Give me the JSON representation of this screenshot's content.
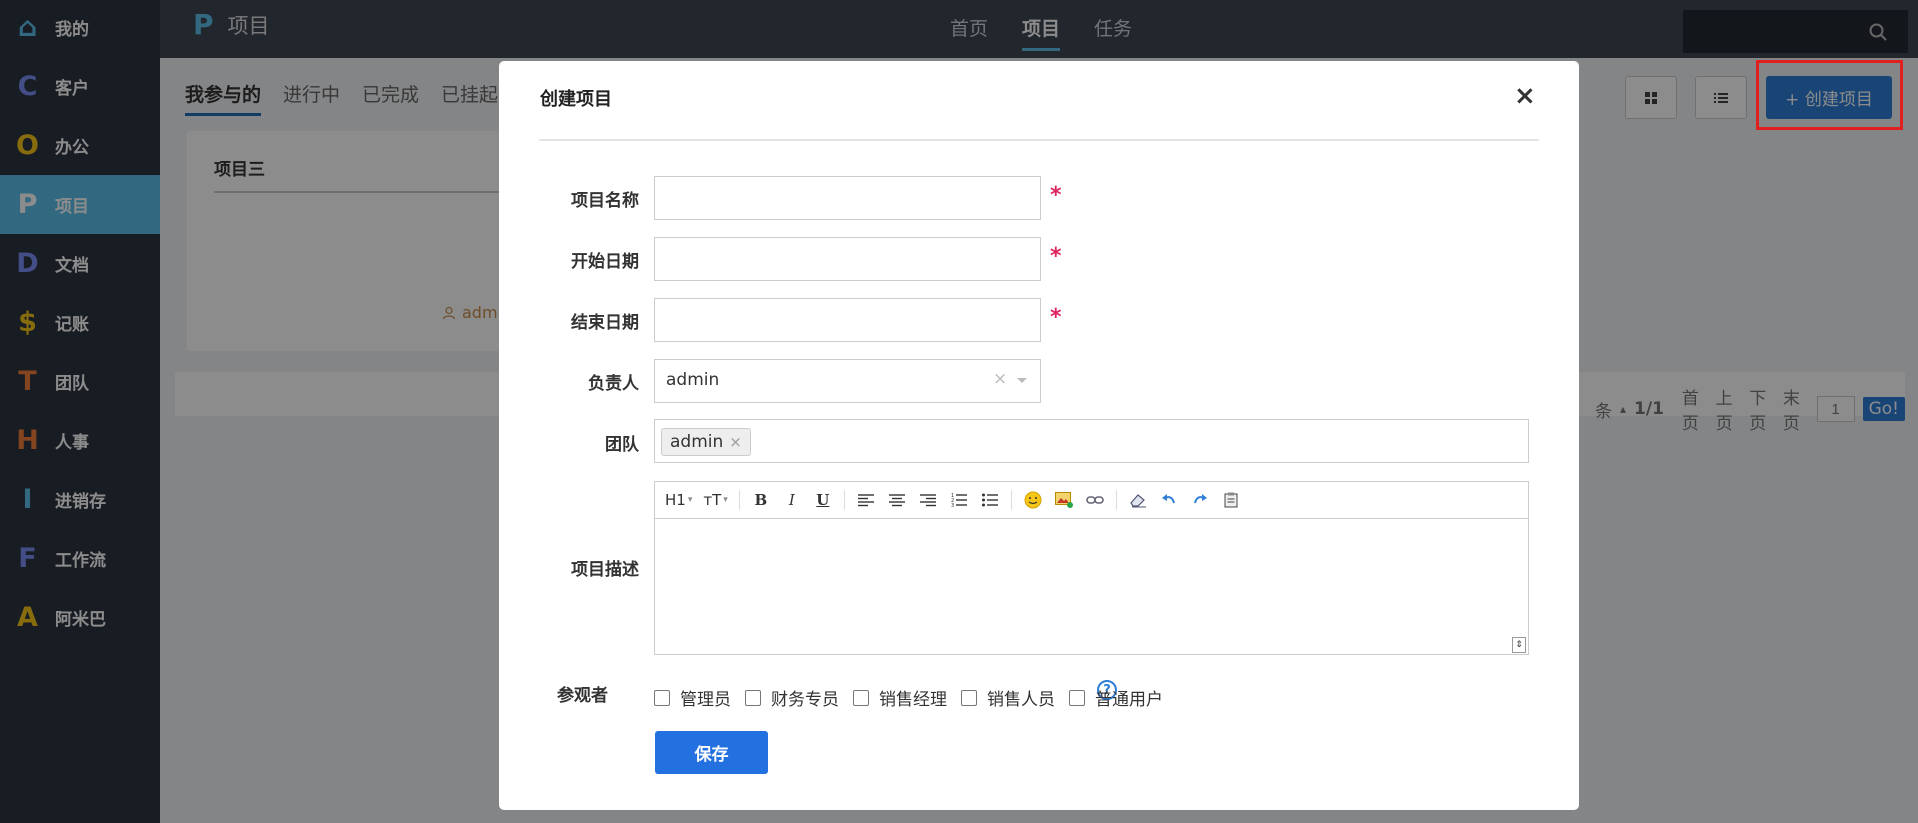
{
  "sidebar": {
    "items": [
      {
        "icon": "home-icon",
        "letter": "⌂",
        "color": "#5bc0eb",
        "label": "我的"
      },
      {
        "icon": "letter-c-icon",
        "letter": "C",
        "color": "#7b8cf5",
        "label": "客户"
      },
      {
        "icon": "letter-o-icon",
        "letter": "O",
        "color": "#f5c518",
        "label": "办公"
      },
      {
        "icon": "letter-p-icon",
        "letter": "P",
        "color": "#ffffff",
        "label": "项目"
      },
      {
        "icon": "letter-d-icon",
        "letter": "D",
        "color": "#7b8cf5",
        "label": "文档"
      },
      {
        "icon": "dollar-icon",
        "letter": "$",
        "color": "#f5c518",
        "label": "记账"
      },
      {
        "icon": "letter-t-icon",
        "letter": "T",
        "color": "#f07d3a",
        "label": "团队"
      },
      {
        "icon": "letter-h-icon",
        "letter": "H",
        "color": "#f07d3a",
        "label": "人事"
      },
      {
        "icon": "letter-i-icon",
        "letter": "I",
        "color": "#5bc0eb",
        "label": "进销存"
      },
      {
        "icon": "letter-f-icon",
        "letter": "F",
        "color": "#7b8cf5",
        "label": "工作流"
      },
      {
        "icon": "letter-a-icon",
        "letter": "A",
        "color": "#f5c518",
        "label": "阿米巴"
      }
    ],
    "active_index": 3
  },
  "topbar": {
    "brand_letter": "P",
    "brand_title": "项目",
    "nav": [
      "首页",
      "项目",
      "任务"
    ],
    "active_nav": "项目"
  },
  "main": {
    "tabs": [
      "我参与的",
      "进行中",
      "已完成",
      "已挂起"
    ],
    "active_tab": "我参与的",
    "create_button": "+ 创建项目",
    "card": {
      "title": "项目三",
      "owner": "admin"
    },
    "pager": {
      "prefix": "条",
      "sort_icon": "▴",
      "page_info": "1/1",
      "first": "首页",
      "prev": "上页",
      "next": "下页",
      "last": "末页",
      "page_input": "1",
      "go": "Go!"
    }
  },
  "modal": {
    "title": "创建项目",
    "close": "×",
    "fields": {
      "name_label": "项目名称",
      "start_label": "开始日期",
      "end_label": "结束日期",
      "owner_label": "负责人",
      "owner_value": "admin",
      "team_label": "团队",
      "team_tag": "admin",
      "desc_label": "项目描述",
      "viewer_label": "参观者",
      "required_mark": "*"
    },
    "viewers": [
      "管理员",
      "财务专员",
      "销售经理",
      "销售人员",
      "普通用户"
    ],
    "toolbar": {
      "heading": "H1",
      "font_size": "ᴛT",
      "bold": "B",
      "italic": "I",
      "underline": "U"
    },
    "save_button": "保存"
  },
  "colors": {
    "sidebar_bg": "#2c3440",
    "active_item": "#5bc0eb",
    "primary": "#2f7ed8",
    "required": "#e0245e",
    "highlight_box": "#e02020"
  }
}
